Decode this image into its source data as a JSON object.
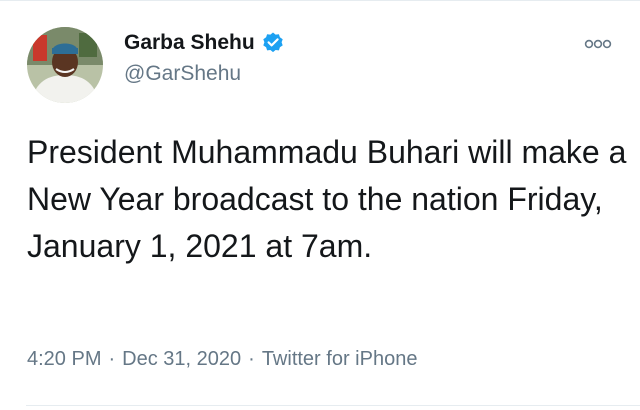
{
  "tweet": {
    "author": {
      "display_name": "Garba Shehu",
      "handle": "@GarShehu",
      "verified": true,
      "avatar_icon": "profile-photo"
    },
    "more_icon": "more-options-icon",
    "text": "President Muhammadu Buhari will make a New Year broadcast to the nation Friday, January 1, 2021 at 7am.",
    "time": "4:20 PM",
    "separator": "·",
    "date": "Dec 31, 2020",
    "source": "Twitter for iPhone"
  },
  "colors": {
    "text_primary": "#14171a",
    "text_secondary": "#657786",
    "verified_blue": "#1da1f2",
    "divider": "#e6ecf0"
  }
}
